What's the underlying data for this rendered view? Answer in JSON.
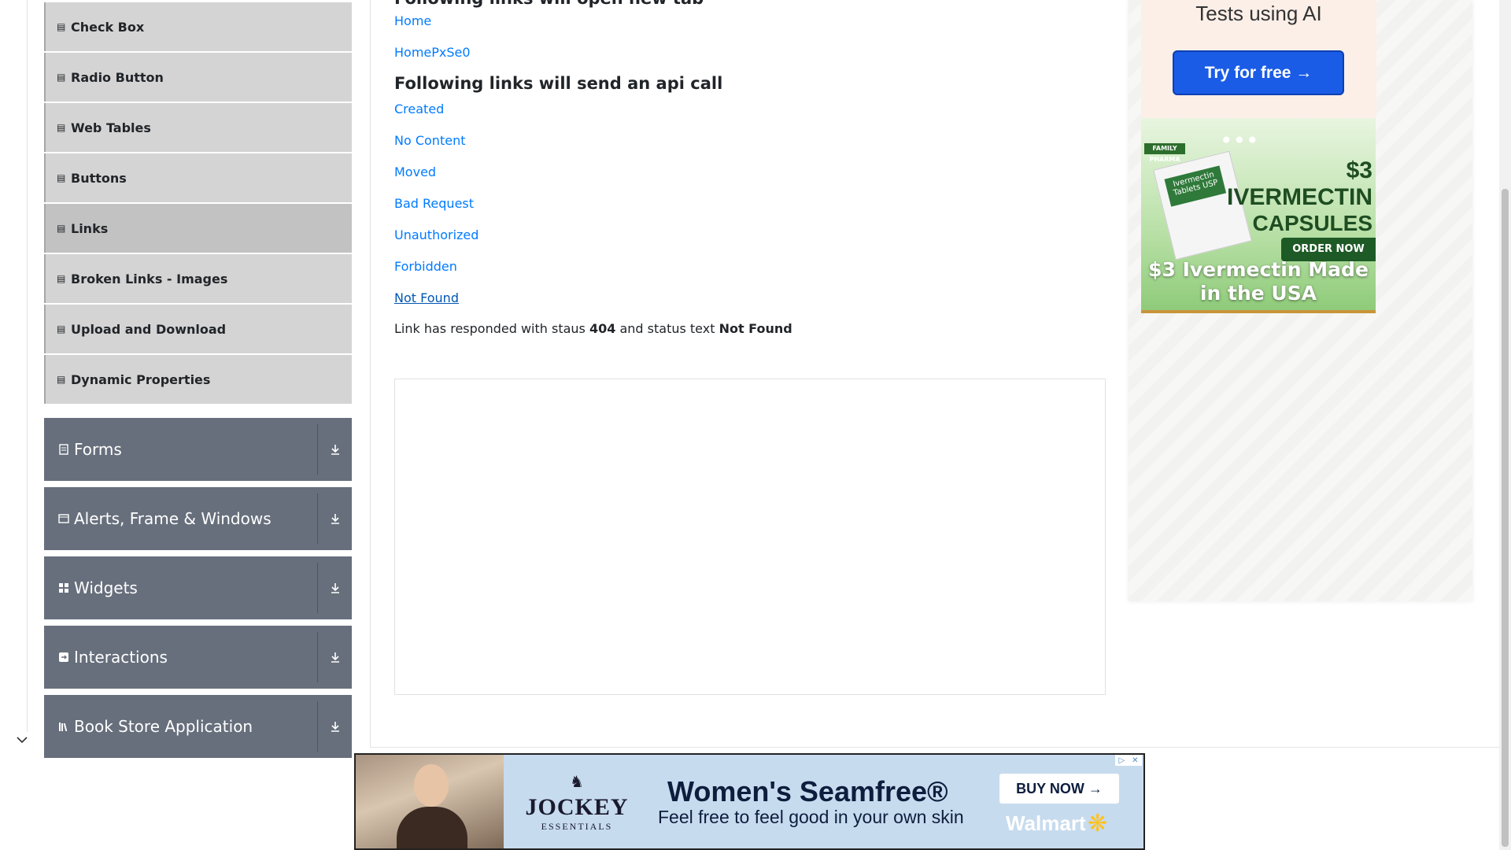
{
  "sidebar": {
    "sub_items": [
      {
        "label": "Check Box",
        "active": false
      },
      {
        "label": "Radio Button",
        "active": false
      },
      {
        "label": "Web Tables",
        "active": false
      },
      {
        "label": "Buttons",
        "active": false
      },
      {
        "label": "Links",
        "active": true
      },
      {
        "label": "Broken Links - Images",
        "active": false
      },
      {
        "label": "Upload and Download",
        "active": false
      },
      {
        "label": "Dynamic Properties",
        "active": false
      }
    ],
    "groups": [
      {
        "label": "Forms",
        "icon": "document-icon"
      },
      {
        "label": "Alerts, Frame & Windows",
        "icon": "window-icon"
      },
      {
        "label": "Widgets",
        "icon": "grid-icon"
      },
      {
        "label": "Interactions",
        "icon": "interaction-icon"
      },
      {
        "label": "Book Store Application",
        "icon": "books-icon"
      }
    ]
  },
  "main": {
    "heading_new_tab": "Following links will open new tab",
    "new_tab_links": [
      "Home",
      "HomePxSe0"
    ],
    "heading_api": "Following links will send an api call",
    "api_links": [
      "Created",
      "No Content",
      "Moved",
      "Bad Request",
      "Unauthorized",
      "Forbidden",
      "Not Found"
    ],
    "response": {
      "prefix": "Link has responded with staus",
      "status_code": "404",
      "middle": "and status text",
      "status_text": "Not Found"
    }
  },
  "ads": {
    "side_top": {
      "title": "Tests using AI",
      "button": "Try for free →"
    },
    "side_medical": {
      "brand": "FAMILY PHARMA",
      "box_label": "Ivermectin Tablets USP",
      "price_line1": "$3",
      "price_line2": "IVERMECTIN",
      "price_line3": "CAPSULES",
      "order": "ORDER NOW",
      "headline": "$3 Ivermectin Made in the USA"
    },
    "banner": {
      "brand": "JOCKEY",
      "brand_sub": "ESSENTIALS",
      "tagline": "Women's Seamfree®",
      "subtagline": "Feel free to feel good in your own skin",
      "button": "BUY NOW →",
      "retailer": "Walmart"
    }
  },
  "colors": {
    "link": "#007bff",
    "group_bg": "#676f7c",
    "sub_item_bg": "#d4d4d4",
    "active_bg": "#c2c2c2"
  }
}
